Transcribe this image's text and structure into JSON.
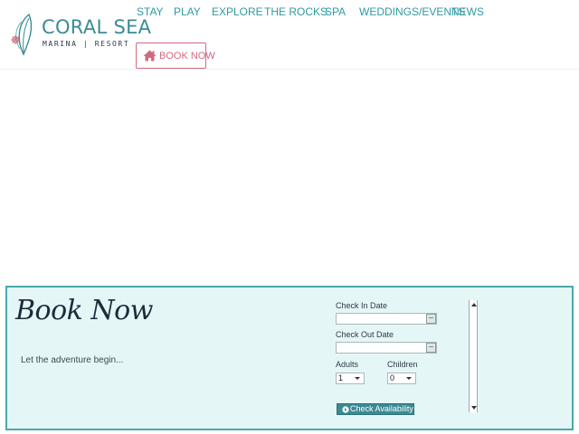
{
  "brand": {
    "name": "CORAL SEA",
    "subtitle": "MARINA | RESORT",
    "accent": "#3a8c95",
    "coral": "#d26a7e"
  },
  "nav": {
    "items": [
      "STAY",
      "PLAY",
      "EXPLORE",
      "THE ROCKS",
      "SPA",
      "WEDDINGS/EVENTS",
      "NEWS"
    ],
    "book_now_label": "BOOK NOW",
    "book_now_icon": "home-icon"
  },
  "booking": {
    "title": "Book Now",
    "tagline": "Let the adventure begin...",
    "check_in_label": "Check In Date",
    "check_in_value": "",
    "check_out_label": "Check Out Date",
    "check_out_value": "",
    "adults_label": "Adults",
    "adults_value": "1",
    "children_label": "Children",
    "children_value": "0",
    "submit_label": "Check Availability",
    "submit_icon": "arrow-circle-right-icon",
    "panel_bg": "#e5f6f6",
    "panel_border": "#4aa8ad"
  }
}
